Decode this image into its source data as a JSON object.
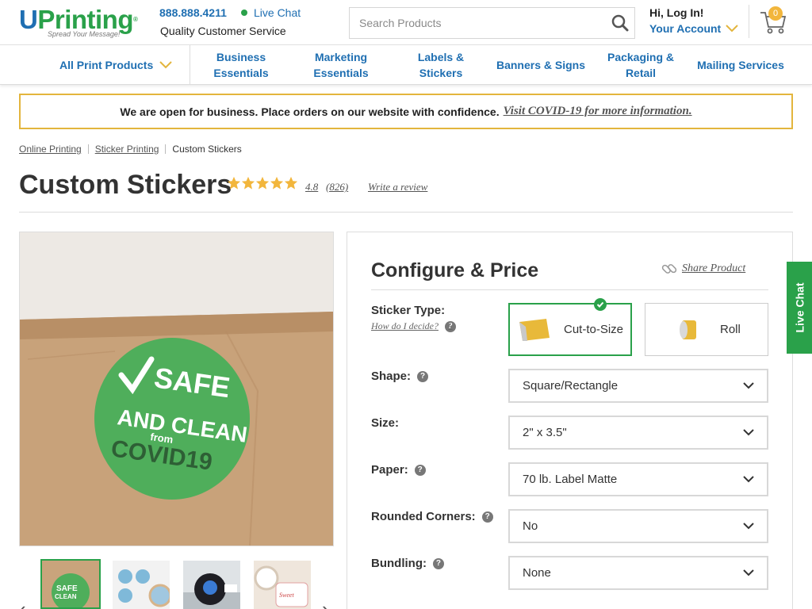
{
  "header": {
    "logo_text_u": "U",
    "logo_text_rest": "Printing",
    "logo_reg": "®",
    "logo_tagline": "Spread Your Message!",
    "phone": "888.888.4211",
    "live_chat": "Live Chat",
    "service": "Quality Customer Service",
    "search_placeholder": "Search Products",
    "greeting": "Hi, Log In!",
    "account": "Your Account",
    "cart_count": "0"
  },
  "nav": {
    "all_products": "All Print Products",
    "items": [
      {
        "label": "Business Essentials"
      },
      {
        "label": "Marketing Essentials"
      },
      {
        "label": "Labels & Stickers"
      },
      {
        "label": "Banners & Signs"
      },
      {
        "label": "Packaging & Retail"
      },
      {
        "label": "Mailing Services"
      }
    ]
  },
  "banner": {
    "text": "We are open for business. Place orders on our website with confidence.",
    "link": "Visit COVID-19 for more information."
  },
  "breadcrumb": [
    "Online Printing",
    "Sticker Printing",
    "Custom Stickers"
  ],
  "product": {
    "title": "Custom Stickers",
    "rating": "4.8",
    "review_count": "(826)",
    "write_review": "Write a review",
    "star_count": 5,
    "image_text": {
      "line1": "SAFE",
      "line2": "AND CLEAN",
      "line3": "from",
      "line4": "COVID19"
    }
  },
  "config": {
    "title": "Configure & Price",
    "share": "Share Product",
    "sticker_type_label": "Sticker Type:",
    "how_decide": "How do I decide?",
    "type_options": [
      {
        "label": "Cut-to-Size",
        "selected": true
      },
      {
        "label": "Roll",
        "selected": false
      }
    ],
    "rows": [
      {
        "label": "Shape:",
        "value": "Square/Rectangle"
      },
      {
        "label": "Size:",
        "value": "2\" x 3.5\""
      },
      {
        "label": "Paper:",
        "value": "70 lb. Label Matte"
      },
      {
        "label": "Rounded Corners:",
        "value": "No"
      },
      {
        "label": "Bundling:",
        "value": "None"
      }
    ]
  },
  "live_chat_tab": "Live Chat",
  "colors": {
    "brand_green": "#2aa14a",
    "brand_blue": "#1f6fb2",
    "banner_border": "#e3b53d",
    "cart_badge": "#f2b63c"
  }
}
